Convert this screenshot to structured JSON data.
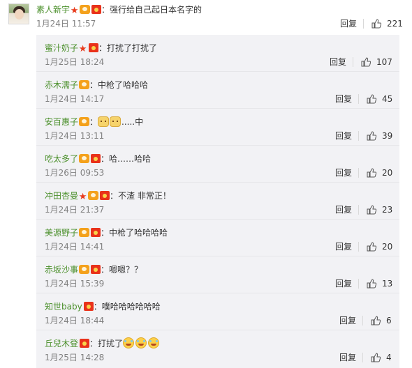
{
  "main_comment": {
    "username": "素人新宇",
    "text": "：强行给自己起日本名字的",
    "timestamp": "1月24日 11:57",
    "reply_label": "回复",
    "likes": "221",
    "badges": [
      "star-badge-icon",
      "vip-crown-icon",
      "red-packet-icon"
    ]
  },
  "replies": [
    {
      "username": "蜜汁奶子",
      "badges": [
        "star",
        "redpack"
      ],
      "text": "：打扰了打扰了",
      "timestamp": "1月25日 18:24",
      "reply_label": "回复",
      "likes": "107"
    },
    {
      "username": "赤木濡子",
      "badges": [
        "vip"
      ],
      "text": "：中枪了哈哈哈",
      "timestamp": "1月24日 14:17",
      "reply_label": "回复",
      "likes": "45"
    },
    {
      "username": "安百惠子",
      "badges": [
        "vip"
      ],
      "text_after_emoji": ".....中",
      "emoji": [
        "cat-face-icon",
        "cat-face-icon"
      ],
      "sep": "：",
      "timestamp": "1月24日 13:11",
      "reply_label": "回复",
      "likes": "39"
    },
    {
      "username": "吃太多了",
      "badges": [
        "vip",
        "redpack"
      ],
      "text": "：哈……哈哈",
      "timestamp": "1月26日 09:53",
      "reply_label": "回复",
      "likes": "20"
    },
    {
      "username": "冲田杏曼",
      "badges": [
        "star",
        "vip",
        "redpack"
      ],
      "text": "：不渣 非常正！",
      "timestamp": "1月24日 21:37",
      "reply_label": "回复",
      "likes": "23"
    },
    {
      "username": "美源野子",
      "badges": [
        "vip",
        "redpack"
      ],
      "text": "：中枪了哈哈哈哈",
      "timestamp": "1月24日 14:41",
      "reply_label": "回复",
      "likes": "20"
    },
    {
      "username": "赤坂沙事",
      "badges": [
        "vip",
        "redpack"
      ],
      "text": "：嗯嗯？？",
      "timestamp": "1月24日 15:39",
      "reply_label": "回复",
      "likes": "13"
    },
    {
      "username": "知世baby",
      "badges": [
        "redpack"
      ],
      "text": "：噗哈哈哈哈哈哈",
      "timestamp": "1月24日 18:44",
      "reply_label": "回复",
      "likes": "6"
    },
    {
      "username": "丘兒木登",
      "badges": [
        "redpack"
      ],
      "text": "：打扰了",
      "emoji": [
        "laughing-crying-icon",
        "laughing-crying-icon",
        "laughing-crying-icon"
      ],
      "timestamp": "1月25日 14:28",
      "reply_label": "回复",
      "likes": "4"
    }
  ],
  "colors": {
    "username": "#4a8f2a",
    "meta": "#808080",
    "reply_bg": "#f2f2f5",
    "star": "#e83a1c",
    "vip": "#f4a11c",
    "red_packet": "#e9311a"
  }
}
